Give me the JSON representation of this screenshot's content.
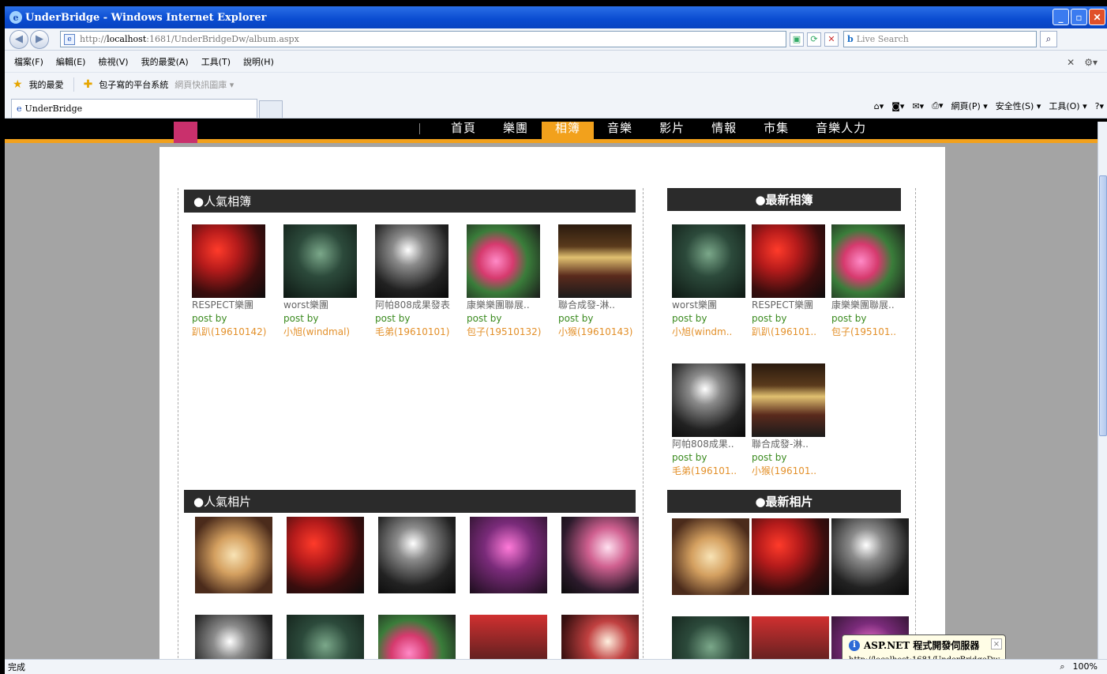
{
  "window": {
    "title": "UnderBridge - Windows Internet Explorer"
  },
  "address": {
    "url_prefix": "http://",
    "url_host": "localhost",
    "url_rest": ":1681/UnderBridgeDw/album.aspx",
    "search_placeholder": "Live Search"
  },
  "menu": [
    "檔案(F)",
    "編輯(E)",
    "檢視(V)",
    "我的最愛(A)",
    "工具(T)",
    "說明(H)"
  ],
  "favorites": {
    "label": "我的最愛",
    "item1": "包子寫的平台系統",
    "item2": "網頁快訊圖庫 ▾"
  },
  "tab": {
    "title": "UnderBridge"
  },
  "cmdbar": {
    "page": "網頁(P) ▾",
    "safety": "安全性(S) ▾",
    "tools": "工具(O) ▾"
  },
  "sitenav": {
    "items": [
      "首頁",
      "樂團",
      "相簿",
      "音樂",
      "影片",
      "情報",
      "市集",
      "音樂人力"
    ],
    "active_index": 2
  },
  "popular_albums": {
    "header": "●人氣相簿",
    "items": [
      {
        "name": "RESPECT樂團",
        "postby": "post by",
        "author": "趴趴(19610142)",
        "photo": "ph-a"
      },
      {
        "name": "worst樂團",
        "postby": "post by",
        "author": "小旭(windmal)",
        "photo": "ph-b"
      },
      {
        "name": "阿帕808成果發表",
        "postby": "post by",
        "author": "毛弟(19610101)",
        "photo": "ph-c"
      },
      {
        "name": "康樂樂團聯展..",
        "postby": "post by",
        "author": "包子(19510132)",
        "photo": "ph-d"
      },
      {
        "name": "聯合成發-淋..",
        "postby": "post by",
        "author": "小猴(19610143)",
        "photo": "ph-e"
      }
    ]
  },
  "new_albums": {
    "header": "●最新相簿",
    "items": [
      {
        "name": "worst樂團",
        "postby": "post by",
        "author": "小旭(windm..",
        "photo": "ph-b"
      },
      {
        "name": "RESPECT樂團",
        "postby": "post by",
        "author": "趴趴(196101..",
        "photo": "ph-a"
      },
      {
        "name": "康樂樂團聯展..",
        "postby": "post by",
        "author": "包子(195101..",
        "photo": "ph-d"
      },
      {
        "name": "阿帕808成果..",
        "postby": "post by",
        "author": "毛弟(196101..",
        "photo": "ph-c"
      },
      {
        "name": "聯合成發-淋..",
        "postby": "post by",
        "author": "小猴(196101..",
        "photo": "ph-e"
      }
    ]
  },
  "popular_photos": {
    "header": "●人氣相片"
  },
  "new_photos": {
    "header": "●最新相片"
  },
  "balloon": {
    "title": "ASP.NET 程式開發伺服器",
    "msg": "http://localhost:1681/UnderBridgeDw",
    "close": "×"
  },
  "status": {
    "text": "完成",
    "zoom": "100%"
  }
}
